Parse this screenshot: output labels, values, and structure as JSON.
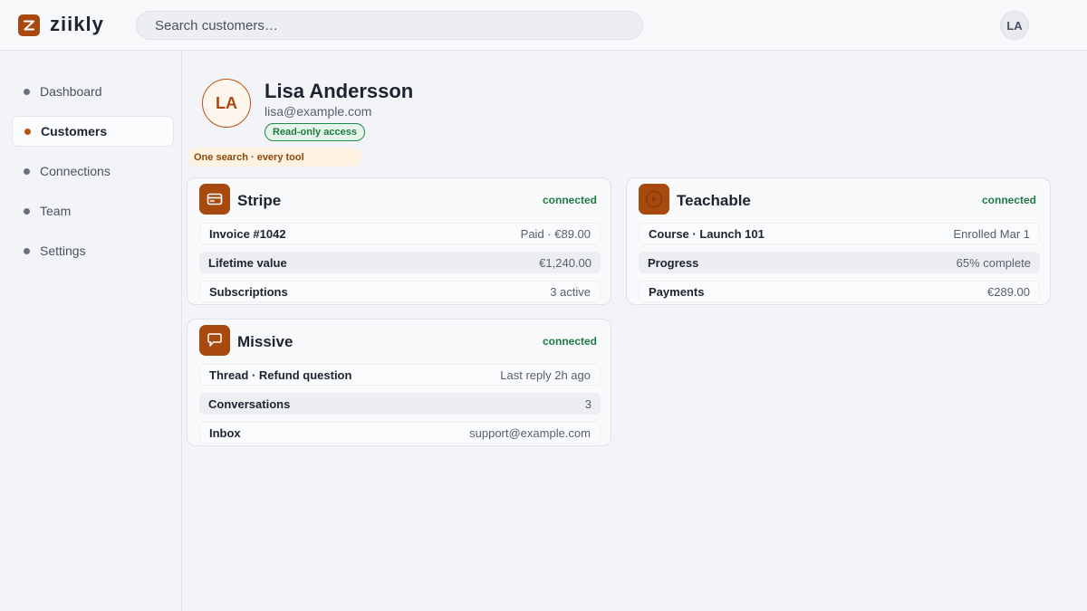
{
  "app": {
    "name": "ziikly",
    "logo_icon": "z-logo-icon",
    "accent": "#a8490f"
  },
  "search": {
    "placeholder": "Search customers…",
    "value": ""
  },
  "user": {
    "initials": "LA"
  },
  "sidebar": {
    "items": [
      {
        "label": "Dashboard",
        "active": false
      },
      {
        "label": "Customers",
        "active": true
      },
      {
        "label": "Connections",
        "active": false
      },
      {
        "label": "Team",
        "active": false
      },
      {
        "label": "Settings",
        "active": false
      }
    ]
  },
  "customer": {
    "initials": "LA",
    "name": "Lisa Andersson",
    "email": "lisa@example.com",
    "access": "Read-only access",
    "tagline": "One search · every tool"
  },
  "cards": [
    {
      "title": "Stripe",
      "icon": "credit-card-icon",
      "status": "connected",
      "rows": [
        {
          "label": "Invoice #1042",
          "value": "Paid · €89.00"
        },
        {
          "label": "Lifetime value",
          "value": "€1,240.00"
        },
        {
          "label": "Subscriptions",
          "value": "3 active"
        }
      ]
    },
    {
      "title": "Teachable",
      "icon": "play-icon",
      "status": "connected",
      "rows": [
        {
          "label": "Course · Launch 101",
          "value": "Enrolled Mar 1"
        },
        {
          "label": "Progress",
          "value": "65% complete"
        },
        {
          "label": "Payments",
          "value": "€289.00"
        }
      ]
    },
    {
      "title": "Missive",
      "icon": "chat-bubble-icon",
      "status": "connected",
      "rows": [
        {
          "label": "Thread · Refund question",
          "value": "Last reply 2h ago"
        },
        {
          "label": "Conversations",
          "value": "3"
        },
        {
          "label": "Inbox",
          "value": "support@example.com"
        }
      ]
    }
  ],
  "colors": {
    "connected": "#1f7a43",
    "brand": "#a8490f",
    "tag_bg": "#fdf1df"
  }
}
